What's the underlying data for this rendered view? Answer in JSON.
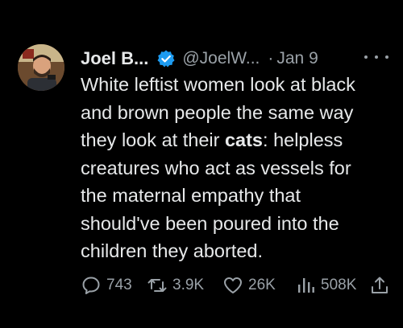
{
  "author": {
    "name": "Joel B...",
    "handle": "@JoelW...",
    "separator": "·",
    "date": "Jan 9",
    "verified": true,
    "verified_color": "#1d9bf0"
  },
  "post": {
    "lines": [
      {
        "before": "White leftist women look at black",
        "bold": "",
        "after": ""
      },
      {
        "before": "and brown people the same way",
        "bold": "",
        "after": ""
      },
      {
        "before": "they look at their ",
        "bold": "cats",
        "after": ": helpless"
      },
      {
        "before": "creatures who act as vessels for",
        "bold": "",
        "after": ""
      },
      {
        "before": "the maternal empathy that",
        "bold": "",
        "after": ""
      },
      {
        "before": "should've been poured into the",
        "bold": "",
        "after": ""
      },
      {
        "before": "children they aborted.",
        "bold": "",
        "after": ""
      }
    ]
  },
  "actions": {
    "replies": "743",
    "reposts": "3.9K",
    "likes": "26K",
    "views": "508K"
  },
  "icons": {
    "more": "more-dots-icon",
    "reply": "reply-icon",
    "repost": "repost-icon",
    "like": "heart-icon",
    "views": "views-bar-chart-icon",
    "share": "share-icon",
    "verified": "verified-badge-icon"
  }
}
